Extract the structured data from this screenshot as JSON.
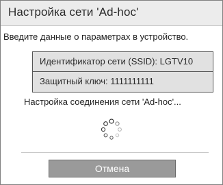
{
  "dialog": {
    "title": "Настройка сети 'Ad-hoc'",
    "instruction": "Введите данные о параметрах в устройство.",
    "network_info": {
      "ssid_row": "Идентификатор сети (SSID): LGTV10",
      "key_row": "Защитный ключ: 1111111111"
    },
    "status_text": "Настройка соединения сети 'Ad-hoc'...",
    "spinner_icon": "loading-spinner-icon",
    "cancel_label": "Отмена"
  },
  "colors": {
    "title_bar": "#ececec",
    "info_box": "#e1e1e1",
    "button": "#9a9a9a",
    "button_text": "#ffffff"
  }
}
